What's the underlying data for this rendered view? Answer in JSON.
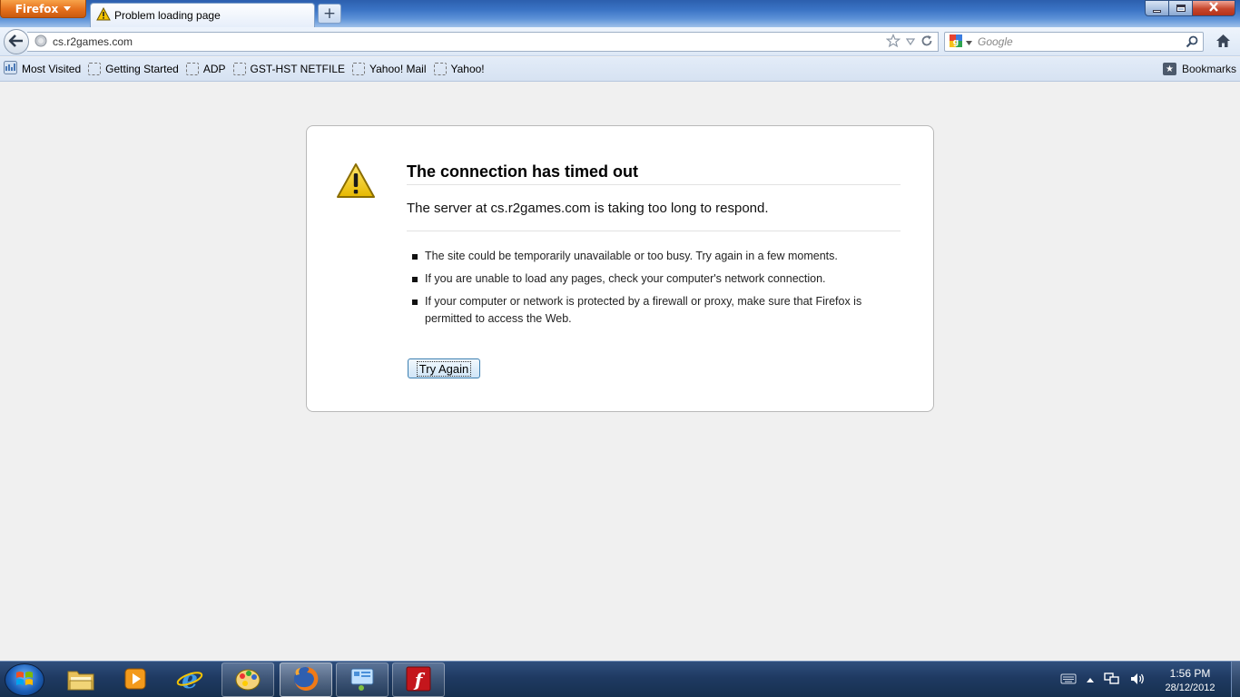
{
  "browser": {
    "menu_button": "Firefox",
    "tab_title": "Problem loading page",
    "new_tab_symbol": "+",
    "url": "cs.r2games.com",
    "search_placeholder": "Google"
  },
  "bookmarks": {
    "items": [
      {
        "label": "Most Visited",
        "icon": "most-visited-icon"
      },
      {
        "label": "Getting Started",
        "icon": "page-placeholder-icon"
      },
      {
        "label": "ADP",
        "icon": "page-placeholder-icon"
      },
      {
        "label": "GST-HST NETFILE",
        "icon": "page-placeholder-icon"
      },
      {
        "label": "Yahoo! Mail",
        "icon": "page-placeholder-icon"
      },
      {
        "label": "Yahoo!",
        "icon": "page-placeholder-icon"
      }
    ],
    "menu_label": "Bookmarks"
  },
  "error": {
    "title": "The connection has timed out",
    "description": "The server at cs.r2games.com is taking too long to respond.",
    "bullets": [
      "The site could be temporarily unavailable or too busy. Try again in a few moments.",
      "If you are unable to load any pages, check your computer's network connection.",
      "If your computer or network is protected by a firewall or proxy, make sure that Firefox is permitted to access the Web."
    ],
    "button_label": "Try Again"
  },
  "taskbar": {
    "apps": [
      {
        "name": "windows-explorer",
        "icon": "folder-icon",
        "state": "pinned"
      },
      {
        "name": "media-player",
        "icon": "media-player-icon",
        "state": "pinned"
      },
      {
        "name": "internet-explorer",
        "icon": "ie-icon",
        "state": "pinned"
      },
      {
        "name": "paint-app",
        "icon": "paint-icon",
        "state": "open"
      },
      {
        "name": "firefox",
        "icon": "firefox-icon",
        "state": "active"
      },
      {
        "name": "control-panel",
        "icon": "control-panel-icon",
        "state": "open"
      },
      {
        "name": "flash",
        "icon": "flash-icon",
        "state": "open"
      }
    ],
    "clock": {
      "time": "1:56 PM",
      "date": "28/12/2012"
    }
  },
  "colors": {
    "firefox_orange": "#e5701d",
    "titlebar_blue": "#3a73c4",
    "page_background": "#f0f0f0",
    "button_border": "#3c7fb1"
  }
}
